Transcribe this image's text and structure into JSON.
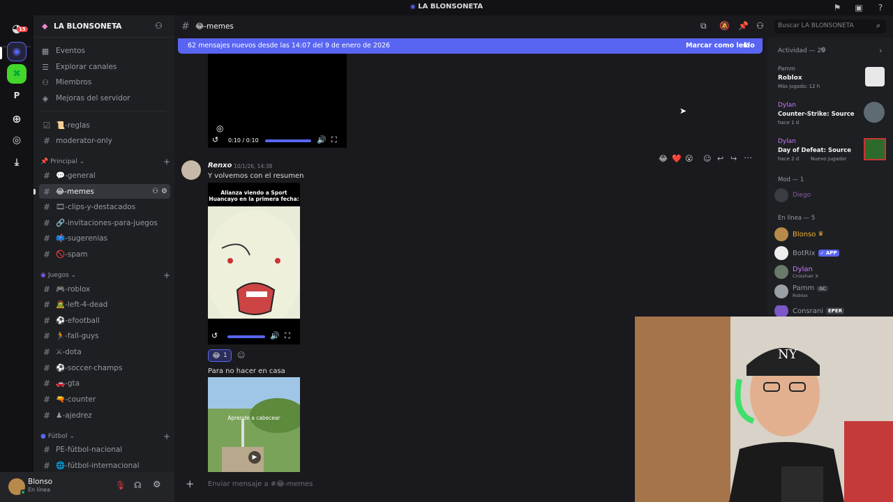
{
  "topbar": {
    "title": "LA BLONSONETA"
  },
  "rail": {
    "notif_count": "15",
    "server_p_letter": "P"
  },
  "server": {
    "name": "LA BLONSONETA",
    "nav": [
      {
        "icon": "calendar-icon",
        "label": "Eventos"
      },
      {
        "icon": "compass-icon",
        "label": "Explorar canales"
      },
      {
        "icon": "members-icon",
        "label": "Miembros"
      },
      {
        "icon": "boost-icon",
        "label": "Mejoras del servidor"
      }
    ],
    "pre_channels": [
      {
        "label": "📜-reglas",
        "icon": "rules-icon"
      },
      {
        "label": "moderator-only",
        "icon": "hash-icon"
      }
    ],
    "categories": [
      {
        "name": "Principal",
        "channels": [
          "💬-general",
          "😂-memes",
          "🎞-clips-y-destacados",
          "🔗-invitaciones-para-juegos",
          "📫-sugerenias",
          "🚫-spam"
        ]
      },
      {
        "name": "Juegos",
        "channels": [
          "🎮-roblox",
          "🧟-left-4-dead",
          "⚽-efootball",
          "🏃-fall-guys",
          "⚔-dota",
          "⚽-soccer-champs",
          "🚗-gta",
          "🔫-counter",
          "♟-ajedrez"
        ]
      },
      {
        "name": "Fútbol",
        "channels": [
          "PE-fútbol-nacional",
          "🌐-fútbol-internacional"
        ]
      }
    ]
  },
  "user": {
    "name": "Blonso",
    "status": "En línea"
  },
  "chat": {
    "channel": "😂-memes",
    "banner_text": "62 mensajes nuevos desde las 14:07 del 9 de enero de 2026",
    "banner_action": "Marcar como leído",
    "video1_time": "0:10 / 0:10",
    "message": {
      "author": "Renxo",
      "timestamp": "10/1/26, 14:38",
      "text": "Y volvemos con el resumen"
    },
    "meme_caption": "Alianza viendo a Sport Huancayo en la primera fecha:",
    "reaction": {
      "emoji": "😂",
      "count": "1"
    },
    "message2_text": "Para no hacer en casa",
    "video2_caption": "Aprende a cabecear",
    "composer_placeholder": "Enviar mensaje a #😂-memes",
    "hover_reactions": [
      "😂",
      "❤️",
      "😮"
    ]
  },
  "search": {
    "placeholder": "Buscar LA BLONSONETA"
  },
  "members": {
    "activity_header": "Actividad — 25",
    "activities": [
      {
        "user": "Pamm",
        "game": "Roblox",
        "sub": "Más jugado: 12 h"
      },
      {
        "user": "Dylan",
        "game": "Counter-Strike: Source",
        "sub": "hace 1 d"
      },
      {
        "user": "Dylan",
        "game": "Day of Defeat: Source",
        "sub": "hace 2 d",
        "extra": "Nuevo jugador"
      }
    ],
    "mod_header": "Mod — 1",
    "mods": [
      {
        "name": "Diego"
      }
    ],
    "online_header": "En línea — 5",
    "online": [
      {
        "name": "Blonso",
        "sub": "",
        "badge": ""
      },
      {
        "name": "BotRix",
        "sub": "",
        "badge": "✓ APP"
      },
      {
        "name": "Dylan",
        "sub": "Crosshair X",
        "badge": ""
      },
      {
        "name": "Pamm",
        "sub": "Roblox",
        "badge": "GC"
      },
      {
        "name": "Consrani",
        "sub": "",
        "badge": "EPER"
      }
    ]
  },
  "colors": {
    "accent": "#5865f2",
    "pink_name": "#c77dff",
    "gold_name": "#f0b232"
  }
}
